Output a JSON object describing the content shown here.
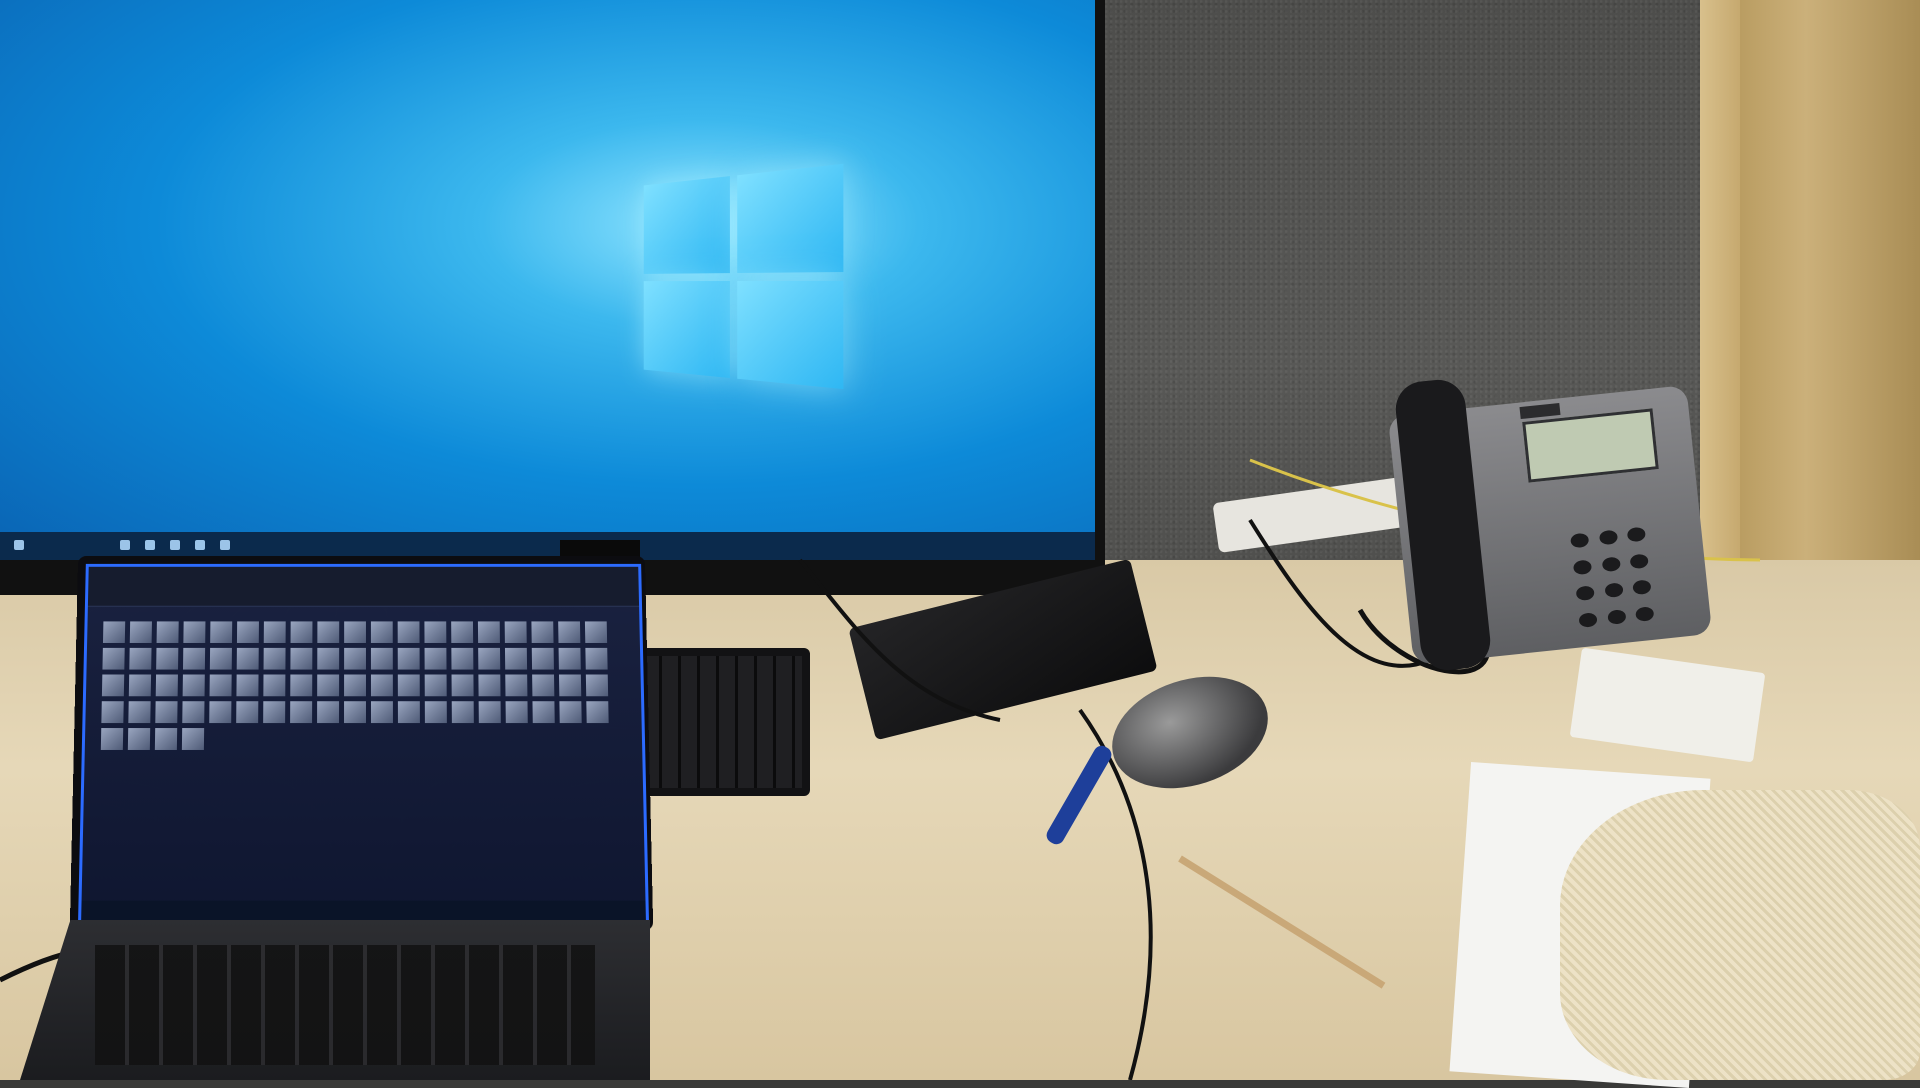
{
  "scene": {
    "description_items": [
      "monitor",
      "laptop",
      "keyboard",
      "docking-station",
      "mouse",
      "ip-phone",
      "cloth",
      "papers",
      "cables"
    ]
  },
  "colors": {
    "desktop_blue": "#0d8ad8",
    "logo_blue": "#7fe0ff",
    "desk": "#e6d8b8",
    "cubicle_wall": "#585856",
    "phone_body": "#8b8b8e"
  },
  "icons": [
    "windows-logo-icon"
  ]
}
